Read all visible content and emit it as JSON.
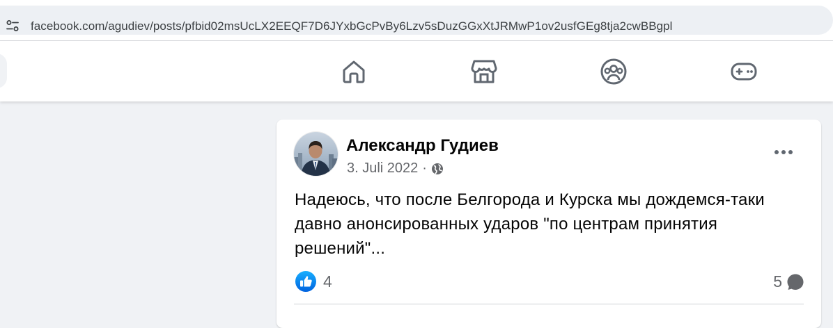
{
  "browser": {
    "url": "facebook.com/agudiev/posts/pfbid02msUcLX2EEQF7D6JYxbGcPvBy6Lzv5sDuzGGxXtJRMwP1ov2usfGEg8tja2cwBBgpl",
    "site_info_icon": "tune-icon"
  },
  "nav": {
    "items": [
      {
        "icon": "home-icon"
      },
      {
        "icon": "marketplace-icon"
      },
      {
        "icon": "groups-icon"
      },
      {
        "icon": "gaming-icon"
      }
    ]
  },
  "post": {
    "author": "Александр Гудиев",
    "date": "3. Juli 2022",
    "separator": "·",
    "audience_icon": "globe-icon",
    "text": "Надеюсь, что после Белгорода и Курска мы дождемся-таки давно анонсированных ударов \"по центрам принятия решений\"...",
    "like_count": "4",
    "comment_count": "5"
  },
  "colors": {
    "accent": "#1877f2",
    "page_bg": "#f0f2f5",
    "secondary_text": "#65676b",
    "icon": "#606770"
  }
}
